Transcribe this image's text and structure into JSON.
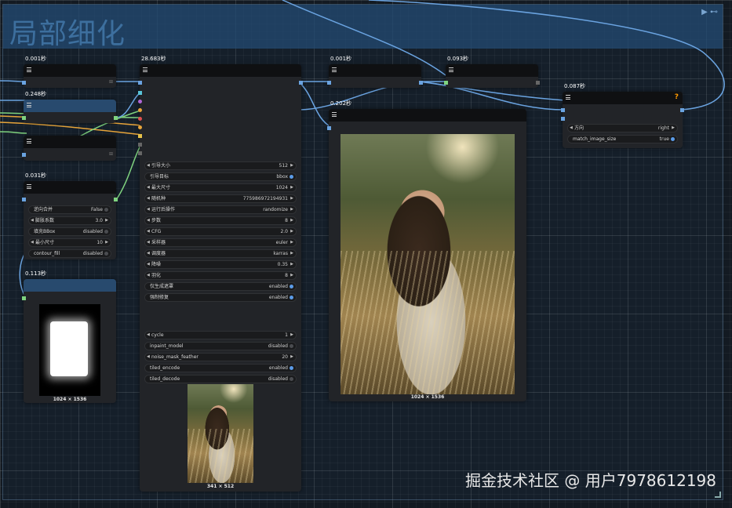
{
  "group": {
    "title": "局部细化",
    "controls": "▶ ⊷"
  },
  "nodes": {
    "n1": {
      "time": "0.001秒"
    },
    "n2": {
      "time": "0.248秒"
    },
    "n3": {
      "time": ""
    },
    "n4": {
      "time": "0.031秒",
      "widgets": [
        {
          "label": "逆向合并",
          "value": "False",
          "type": "toggle",
          "on": false
        },
        {
          "label": "膨胀系数",
          "value": "3.0",
          "type": "number"
        },
        {
          "label": "填充BBox",
          "value": "disabled",
          "type": "toggle",
          "on": false
        },
        {
          "label": "最小尺寸",
          "value": "10",
          "type": "number"
        },
        {
          "label": "contour_fill",
          "value": "disabled",
          "type": "toggle",
          "on": false
        }
      ]
    },
    "n5": {
      "time": "0.113秒",
      "caption": "1024 × 1536"
    },
    "big": {
      "time": "28.683秒",
      "widgets": [
        {
          "label": "引导大小",
          "value": "512",
          "type": "number"
        },
        {
          "label": "引导目标",
          "value": "bbox",
          "type": "toggle",
          "on": true
        },
        {
          "label": "最大尺寸",
          "value": "1024",
          "type": "number"
        },
        {
          "label": "随机种",
          "value": "775986972194931",
          "type": "number"
        },
        {
          "label": "运行后操作",
          "value": "randomize",
          "type": "number"
        },
        {
          "label": "步数",
          "value": "8",
          "type": "number"
        },
        {
          "label": "CFG",
          "value": "2.0",
          "type": "number"
        },
        {
          "label": "采样器",
          "value": "euler",
          "type": "number"
        },
        {
          "label": "调度器",
          "value": "karras",
          "type": "number"
        },
        {
          "label": "降噪",
          "value": "0.35",
          "type": "number"
        },
        {
          "label": "羽化",
          "value": "8",
          "type": "number"
        },
        {
          "label": "仅生成遮罩",
          "value": "enabled",
          "type": "toggle",
          "on": true
        },
        {
          "label": "强制修复",
          "value": "enabled",
          "type": "toggle",
          "on": true
        }
      ],
      "widgets2": [
        {
          "label": "cycle",
          "value": "1",
          "type": "number"
        },
        {
          "label": "inpaint_model",
          "value": "disabled",
          "type": "toggle",
          "on": false
        },
        {
          "label": "noise_mask_feather",
          "value": "20",
          "type": "number"
        },
        {
          "label": "tiled_encode",
          "value": "enabled",
          "type": "toggle",
          "on": true
        },
        {
          "label": "tiled_decode",
          "value": "disabled",
          "type": "toggle",
          "on": false
        }
      ],
      "caption": "341 × 512"
    },
    "n6": {
      "time": "0.001秒"
    },
    "n7": {
      "time": "0.093秒"
    },
    "n8": {
      "time": "0.202秒",
      "caption": "1024 × 1536"
    },
    "n9": {
      "time": "0.087秒",
      "help": "?",
      "widgets": [
        {
          "label": "方向",
          "value": "right",
          "type": "number"
        },
        {
          "label": "match_image_size",
          "value": "true",
          "type": "toggle",
          "on": true
        }
      ]
    }
  },
  "watermark": "掘金技术社区 @ 用户7978612198",
  "colors": {
    "group_header": "#284a6e",
    "node_body": "#222428",
    "link_blue": "#6aa3e0",
    "link_green": "#7fd37f",
    "link_orange": "#e8a53a",
    "toggle_on": "#5b9be8"
  }
}
